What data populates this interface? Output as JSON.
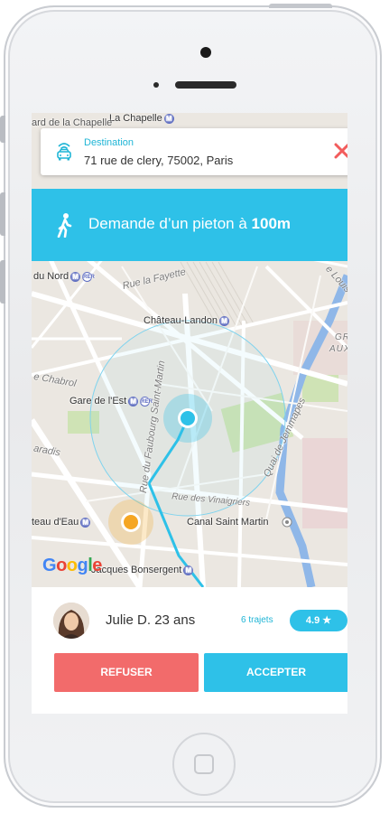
{
  "destination": {
    "label": "Destination",
    "address": "71 rue de clery, 75002, Paris"
  },
  "banner": {
    "text_prefix": "Demande d’un pieton à ",
    "distance": "100m"
  },
  "map": {
    "labels": {
      "chapelle_top": "La Chapelle",
      "chapelle_street": "ard de la Chapelle",
      "du_nord": "du Nord",
      "rue_lafayette": "Rue la Fayette",
      "chateau_landon": "Château-Landon",
      "gare_est": "Gare de l'Est",
      "chabrol": "e Chabrol",
      "paradis": "aradis",
      "faubourg_st_martin": "Rue du Faubourg Saint-Martin",
      "quai_jemmapes": "Quai de Jemmapes",
      "rue_vinaigriers": "Rue des Vinaigriers",
      "chateau_eau": "teau d'Eau",
      "canal_st_martin": "Canal Saint Martin",
      "jacques_bonsergent": "Jacques Bonsergent",
      "louis_bl": "e Louis B",
      "gra": "GRA",
      "aux_b": "AUX B"
    },
    "metro_symbol": "M",
    "rer_symbol": "RER",
    "google_letters": [
      "G",
      "o",
      "o",
      "g",
      "l",
      "e"
    ]
  },
  "user": {
    "name": "Julie D.",
    "age": "23 ans",
    "trips": "6 trajets",
    "rating": "4.9 ★"
  },
  "actions": {
    "refuse": "REFUSER",
    "accept": "ACCEPTER"
  },
  "colors": {
    "accent": "#2ec1e8",
    "refuse": "#f26b6b",
    "walker_marker": "#f5a623",
    "destination_marker": "#2ec1e8"
  }
}
